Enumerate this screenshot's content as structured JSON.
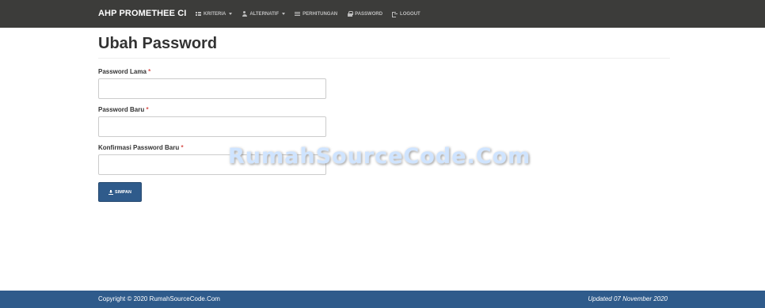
{
  "app": {
    "brand": "AHP PROMETHEE CI"
  },
  "nav": {
    "items": [
      {
        "label": "KRITERIA",
        "icon": "grid-icon",
        "dropdown": true
      },
      {
        "label": "ALTERNATIF",
        "icon": "user-icon",
        "dropdown": true
      },
      {
        "label": "PERHITUNGAN",
        "icon": "list-icon",
        "dropdown": false
      },
      {
        "label": "PASSWORD",
        "icon": "lock-icon",
        "dropdown": false
      },
      {
        "label": "LOGOUT",
        "icon": "logout-icon",
        "dropdown": false
      }
    ]
  },
  "page": {
    "title": "Ubah Password"
  },
  "form": {
    "fields": [
      {
        "label": "Password Lama",
        "required_mark": "*",
        "value": ""
      },
      {
        "label": "Password Baru",
        "required_mark": "*",
        "value": ""
      },
      {
        "label": "Konfirmasi Password Baru",
        "required_mark": "*",
        "value": ""
      }
    ],
    "submit_label": "SIMPAN",
    "submit_icon": "download-icon"
  },
  "watermark": {
    "text": "RumahSourceCode.Com"
  },
  "footer": {
    "copyright": "Copyright © 2020 RumahSourceCode.Com",
    "updated": "Updated 07 November 2020"
  },
  "colors": {
    "navbar": "#3c3c3a",
    "primary": "#2f5b8b",
    "required": "#d9534f"
  }
}
